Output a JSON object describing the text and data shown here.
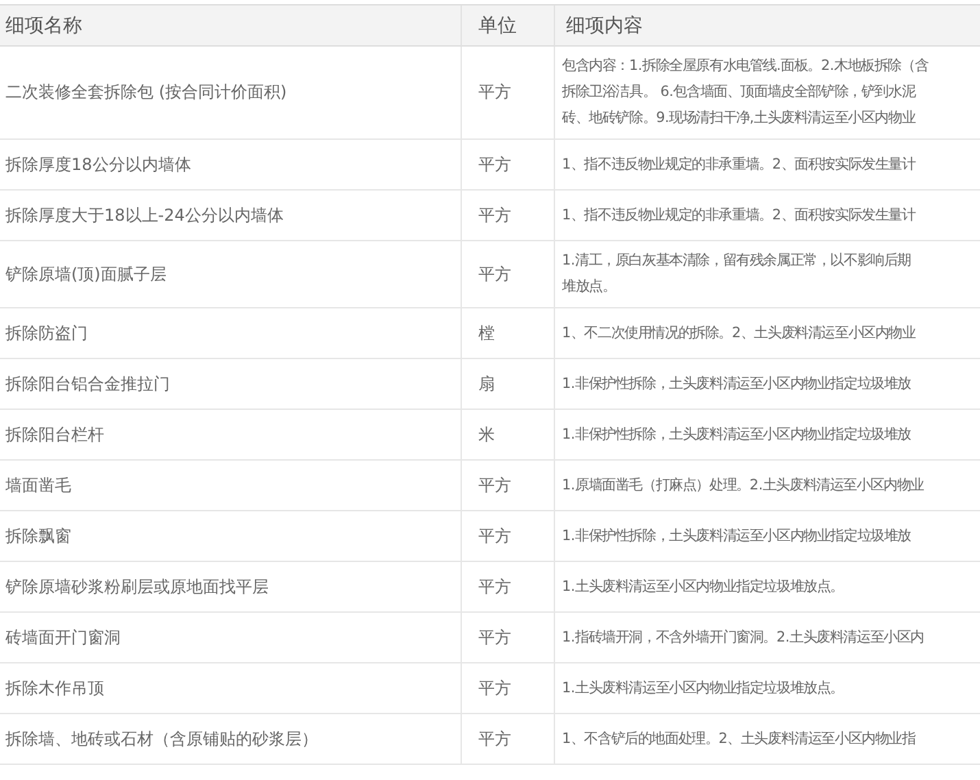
{
  "table": {
    "columns": [
      "细项名称",
      "单位",
      "细项内容"
    ],
    "rows": [
      {
        "name": "二次装修全套拆除包 (按合同计价面积)",
        "unit": "平方",
        "content": [
          "包含内容：1.拆除全屋原有水电管线.面板。2.木地板拆除（含",
          "拆除卫浴洁具。 6.包含墙面、顶面墙皮全部铲除，铲到水泥",
          "砖、地砖铲除。9.现场清扫干净,土头废料清运至小区内物业"
        ]
      },
      {
        "name": "拆除厚度18公分以内墙体",
        "unit": "平方",
        "content": [
          "1、指不违反物业规定的非承重墙。2、面积按实际发生量计"
        ]
      },
      {
        "name": "拆除厚度大于18以上-24公分以内墙体",
        "unit": "平方",
        "content": [
          "1、指不违反物业规定的非承重墙。2、面积按实际发生量计"
        ]
      },
      {
        "name": "铲除原墙(顶)面腻子层",
        "unit": "平方",
        "content": [
          "1.清工，原白灰基本清除，留有残余属正常，以不影响后期",
          "堆放点。"
        ]
      },
      {
        "name": "拆除防盗门",
        "unit": "樘",
        "content": [
          "1、不二次使用情况的拆除。2、土头废料清运至小区内物业"
        ]
      },
      {
        "name": "拆除阳台铝合金推拉门",
        "unit": "扇",
        "content": [
          "1.非保护性拆除，土头废料清运至小区内物业指定垃圾堆放"
        ]
      },
      {
        "name": "拆除阳台栏杆",
        "unit": "米",
        "content": [
          "1.非保护性拆除，土头废料清运至小区内物业指定垃圾堆放"
        ]
      },
      {
        "name": "墙面凿毛",
        "unit": "平方",
        "content": [
          "1.原墙面凿毛（打麻点）处理。2.土头废料清运至小区内物业"
        ]
      },
      {
        "name": "拆除飘窗",
        "unit": "平方",
        "content": [
          "1.非保护性拆除，土头废料清运至小区内物业指定垃圾堆放"
        ]
      },
      {
        "name": "铲除原墙砂浆粉刷层或原地面找平层",
        "unit": "平方",
        "content": [
          "1.土头废料清运至小区内物业指定垃圾堆放点。"
        ]
      },
      {
        "name": "砖墙面开门窗洞",
        "unit": "平方",
        "content": [
          "1.指砖墙开洞，不含外墙开门窗洞。2.土头废料清运至小区内"
        ]
      },
      {
        "name": "拆除木作吊顶",
        "unit": "平方",
        "content": [
          "1.土头废料清运至小区内物业指定垃圾堆放点。"
        ]
      },
      {
        "name": "拆除墙、地砖或石材（含原铺贴的砂浆层）",
        "unit": "平方",
        "content": [
          "1、不含铲后的地面处理。2、土头废料清运至小区内物业指"
        ]
      }
    ]
  }
}
